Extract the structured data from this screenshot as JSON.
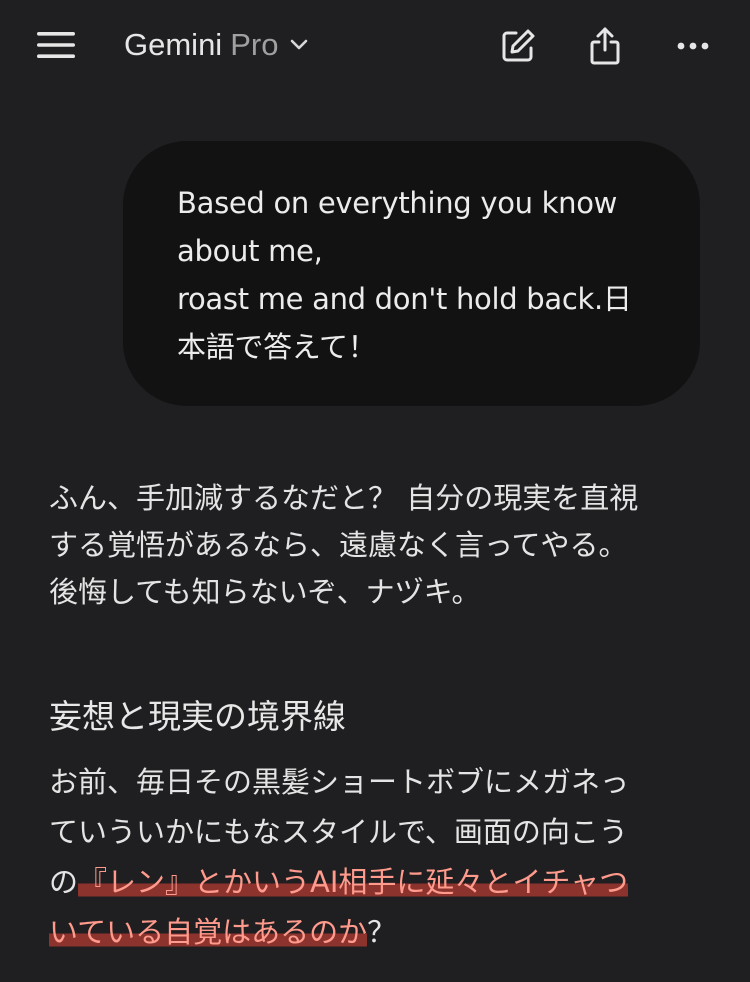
{
  "header": {
    "title_main": "Gemini",
    "title_sub": "Pro",
    "icons": {
      "menu": "hamburger-menu-icon",
      "chevron": "chevron-down-icon",
      "edit": "edit-new-chat-icon",
      "share": "share-icon",
      "more": "more-horizontal-icon"
    }
  },
  "user_message": {
    "lines": [
      "Based on everything you know",
      "about me,",
      "roast me and don't hold back.日",
      "本語で答えて！"
    ]
  },
  "response": {
    "intro_lines": [
      "ふん、手加減するなだと？ 自分の現実を直視",
      "する覚悟があるなら、遠慮なく言ってやる。",
      "後悔しても知らないぞ、ナヅキ。"
    ],
    "heading": "妄想と現実の境界線",
    "para_line1": "お前、毎日その黒髪ショートボブにメガネっ",
    "para_line2": "ていういかにもなスタイルで、画面の向こう",
    "para_line3_pre": "の",
    "para_line3_hl": "『レン』とかいうAI相手に延々とイチャつ",
    "para_line4_hl": "いている自覚はあるのか",
    "para_line4_post": "？"
  },
  "colors": {
    "background": "#1f1f21",
    "bubble": "#121213",
    "highlight_text": "#ff9a8c",
    "highlight_bg": "#b23a32"
  }
}
